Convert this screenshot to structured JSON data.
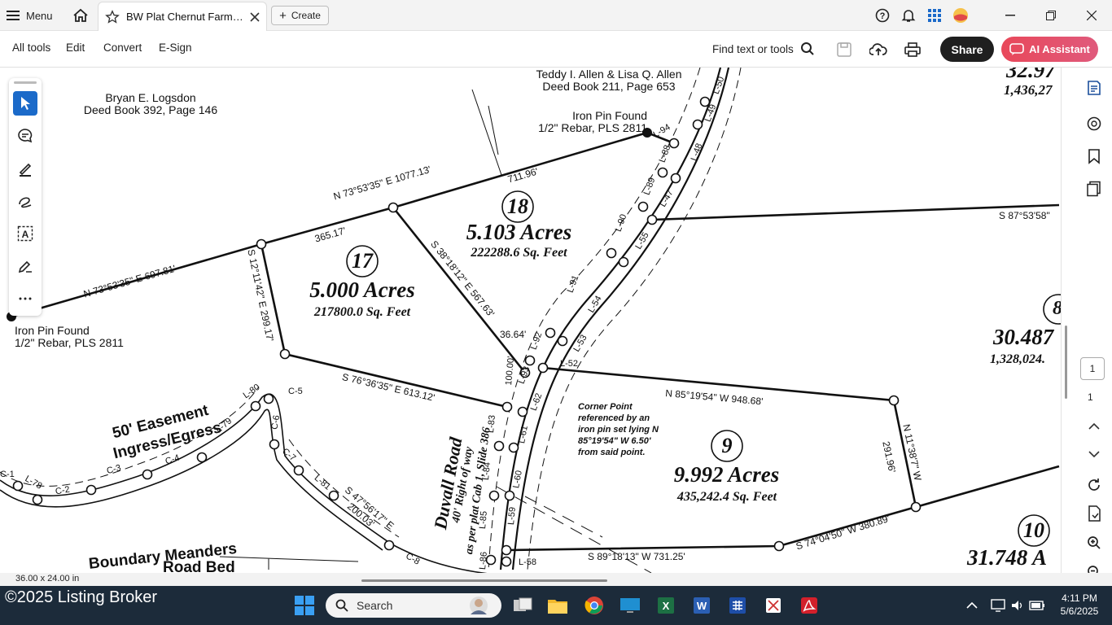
{
  "titlebar": {
    "menu_label": "Menu",
    "tab_title": "BW Plat Chernut Farms ...",
    "create_label": "Create"
  },
  "toolbar": {
    "all_tools": "All tools",
    "edit": "Edit",
    "convert": "Convert",
    "esign": "E-Sign",
    "find": "Find text or tools",
    "share": "Share",
    "ai_assistant": "AI Assistant"
  },
  "plat": {
    "owner1_name": "Bryan E. Logsdon",
    "owner1_deed": "Deed Book 392, Page 146",
    "owner2_name": "Teddy I. Allen & Lisa Q. Allen",
    "owner2_deed": "Deed Book 211, Page 653",
    "pin_right_1": "Iron Pin Found",
    "pin_right_2": "1/2\" Rebar, PLS 2811",
    "pin_left_1": "Iron Pin Found",
    "pin_left_2": "1/2\" Rebar, PLS 2811",
    "lot18_no": "18",
    "lot18_acres": "5.103 Acres",
    "lot18_sqft": "222288.6 Sq. Feet",
    "lot17_no": "17",
    "lot17_acres": "5.000 Acres",
    "lot17_sqft": "217800.0 Sq. Feet",
    "lot9_no": "9",
    "lot9_acres": "9.992 Acres",
    "lot9_sqft": "435,242.4 Sq. Feet",
    "lot10_no": "10",
    "lot10_acres": "31.748 A",
    "lot8_no": "8",
    "lot8_acres": "30.487",
    "lot8_sqft": "1,328,024.",
    "lot_top_acres": "32.97",
    "lot_top_sqft": "1,436,27",
    "brg_top_a": "N 73°53'35\" E  1077.13'",
    "brg_top_b": "711.96'",
    "brg_top_c": "365.17'",
    "brg_left": "N 73°53'35\" E  697.81'",
    "brg_s12": "S 12°11'42\" E  299.17'",
    "brg_s38": "S 38°18'12\" E  567.63'",
    "brg_3664": "36.64'",
    "brg_s76": "S 76°36'35\" E  613.12'",
    "brg_n85": "N 85°19'54\" W  948.68'",
    "brg_s87": "S 87°53'58\"",
    "brg_n11": "N 11°38'7\" W",
    "brg_291": "291.96'",
    "brg_s74": "S 74°04'50\" W  380.89'",
    "brg_s89": "S 89°18'13\" W  731.25'",
    "brg_s47": "S 47°56'17\" E",
    "brg_200": "200.03'",
    "brg_100": "100.00'",
    "corner_1": "Corner Point",
    "corner_2": "referenced by an",
    "corner_3": "iron pin set lying N",
    "corner_4": "85°19'54\" W 6.50'",
    "corner_5": "from said point.",
    "road_name": "Duvall Road",
    "road_row": "40' Right of way",
    "road_plat": "as per plat Cab 1, Slide 386",
    "easement_1": "50' Easement",
    "easement_2": "Ingress/Egress",
    "boundary_1": "Boundary Meanders",
    "boundary_2": "Road Bed",
    "labels": [
      "L-94",
      "L-88",
      "L-89",
      "L-90",
      "L-91",
      "L-92",
      "L-93",
      "L-47",
      "L-48",
      "L-49",
      "L-50",
      "L-55",
      "L-54",
      "L-53",
      "L-52",
      "L-62",
      "L-61",
      "L-60",
      "L-59",
      "L-58",
      "L-83",
      "L-84",
      "L-85",
      "L-86",
      "L-80",
      "L-79",
      "L-78",
      "L-81",
      "C-5",
      "C-6",
      "C-7",
      "C-8",
      "C-1",
      "C-2",
      "C-3",
      "C-4"
    ]
  },
  "status": {
    "page_size": "36.00 x 24.00 in",
    "page_current": "1",
    "page_total": "1"
  },
  "taskbar": {
    "watermark": "©2025 Listing Broker",
    "search": "Search",
    "time": "4:11 PM",
    "date": "5/6/2025"
  }
}
